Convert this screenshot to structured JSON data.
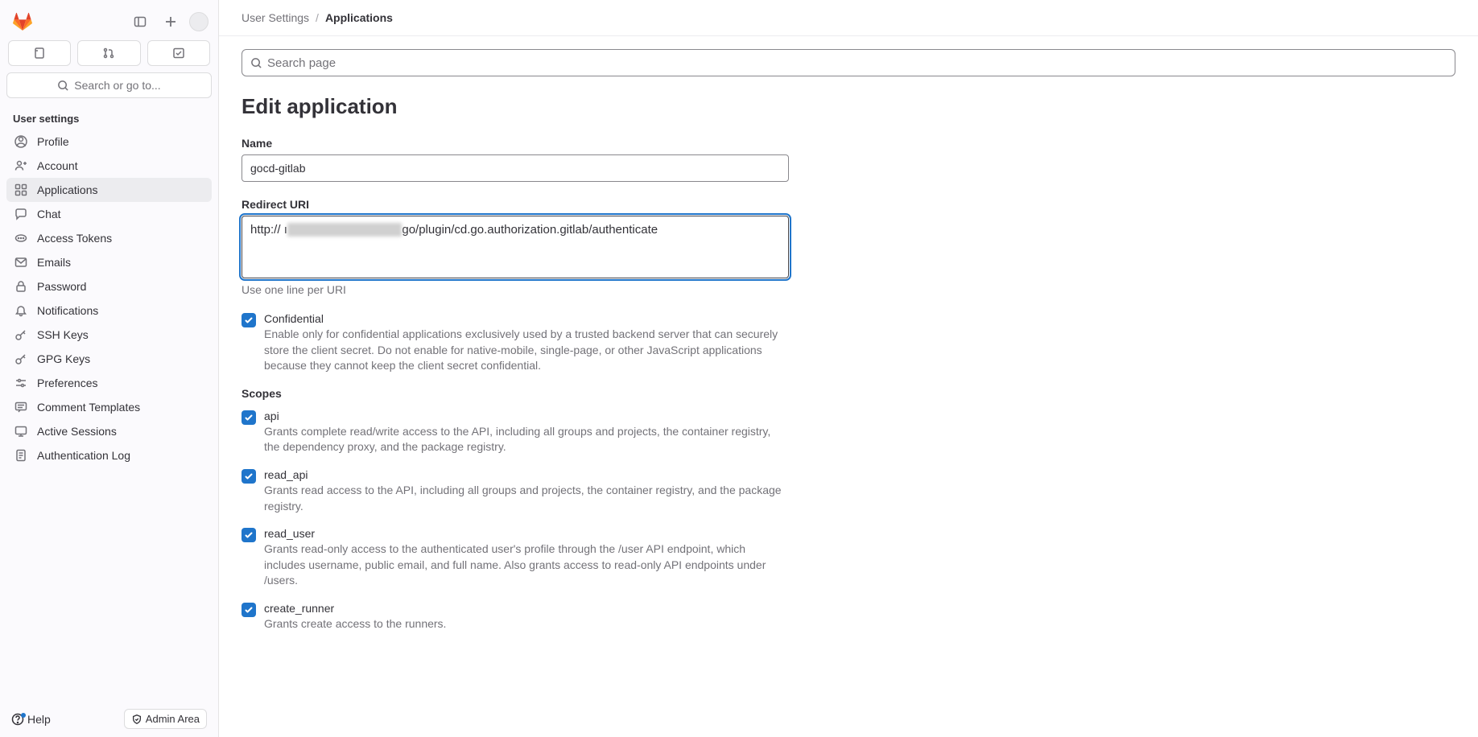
{
  "sidebar": {
    "search_label": "Search or go to...",
    "section_title": "User settings",
    "items": [
      {
        "label": "Profile",
        "icon": "profile-icon",
        "active": false
      },
      {
        "label": "Account",
        "icon": "account-icon",
        "active": false
      },
      {
        "label": "Applications",
        "icon": "applications-icon",
        "active": true
      },
      {
        "label": "Chat",
        "icon": "chat-icon",
        "active": false
      },
      {
        "label": "Access Tokens",
        "icon": "token-icon",
        "active": false
      },
      {
        "label": "Emails",
        "icon": "mail-icon",
        "active": false
      },
      {
        "label": "Password",
        "icon": "lock-icon",
        "active": false
      },
      {
        "label": "Notifications",
        "icon": "bell-icon",
        "active": false
      },
      {
        "label": "SSH Keys",
        "icon": "key-icon",
        "active": false
      },
      {
        "label": "GPG Keys",
        "icon": "key-icon",
        "active": false
      },
      {
        "label": "Preferences",
        "icon": "preferences-icon",
        "active": false
      },
      {
        "label": "Comment Templates",
        "icon": "comment-icon",
        "active": false
      },
      {
        "label": "Active Sessions",
        "icon": "monitor-icon",
        "active": false
      },
      {
        "label": "Authentication Log",
        "icon": "log-icon",
        "active": false
      }
    ],
    "help_label": "Help",
    "admin_label": "Admin Area"
  },
  "breadcrumbs": {
    "parent": "User Settings",
    "current": "Applications"
  },
  "page": {
    "search_placeholder": "Search page",
    "title": "Edit application",
    "name_label": "Name",
    "name_value": "gocd-gitlab",
    "redirect_label": "Redirect URI",
    "redirect_prefix": "http:// ı",
    "redirect_suffix": "ɡo/plugin/cd.go.authorization.gitlab/authenticate",
    "redirect_help": "Use one line per URI",
    "confidential": {
      "label": "Confidential",
      "desc": "Enable only for confidential applications exclusively used by a trusted backend server that can securely store the client secret. Do not enable for native-mobile, single-page, or other JavaScript applications because they cannot keep the client secret confidential."
    },
    "scopes_label": "Scopes",
    "scopes": [
      {
        "name": "api",
        "desc": "Grants complete read/write access to the API, including all groups and projects, the container registry, the dependency proxy, and the package registry."
      },
      {
        "name": "read_api",
        "desc": "Grants read access to the API, including all groups and projects, the container registry, and the package registry."
      },
      {
        "name": "read_user",
        "desc": "Grants read-only access to the authenticated user's profile through the /user API endpoint, which includes username, public email, and full name. Also grants access to read-only API endpoints under /users."
      },
      {
        "name": "create_runner",
        "desc": "Grants create access to the runners."
      }
    ]
  }
}
